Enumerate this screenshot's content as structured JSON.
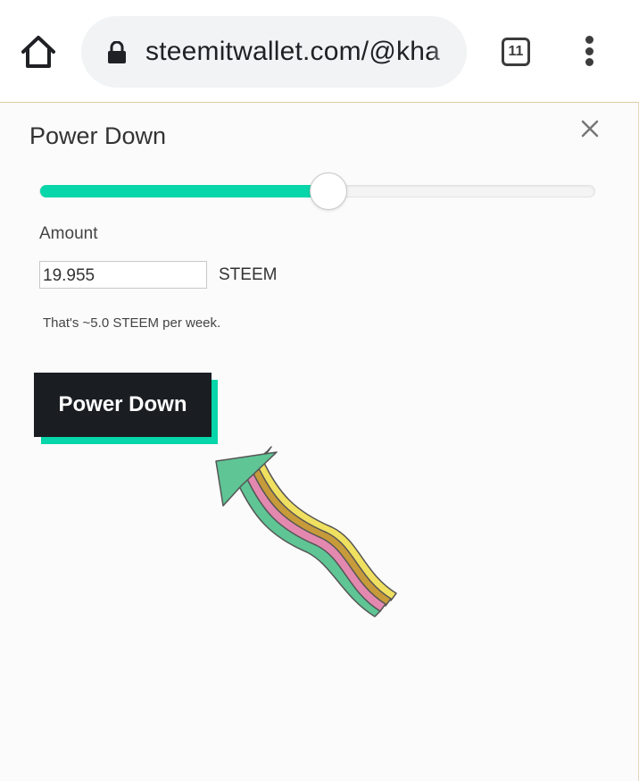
{
  "browser": {
    "url": "steemitwallet.com/@kha",
    "tab_count": "11"
  },
  "modal": {
    "title": "Power Down",
    "slider_fraction": 0.52,
    "amount_label": "Amount",
    "amount_value": "19.955",
    "unit": "STEEM",
    "weekly_note": "That's ~5.0 STEEM per week.",
    "button_label": "Power Down"
  },
  "colors": {
    "accent": "#06d6a9",
    "button_bg": "#1a1e22"
  },
  "icons": [
    "home-icon",
    "lock-icon",
    "tabs-icon",
    "more-vert-icon",
    "close-icon",
    "arrow-annotation-icon"
  ]
}
